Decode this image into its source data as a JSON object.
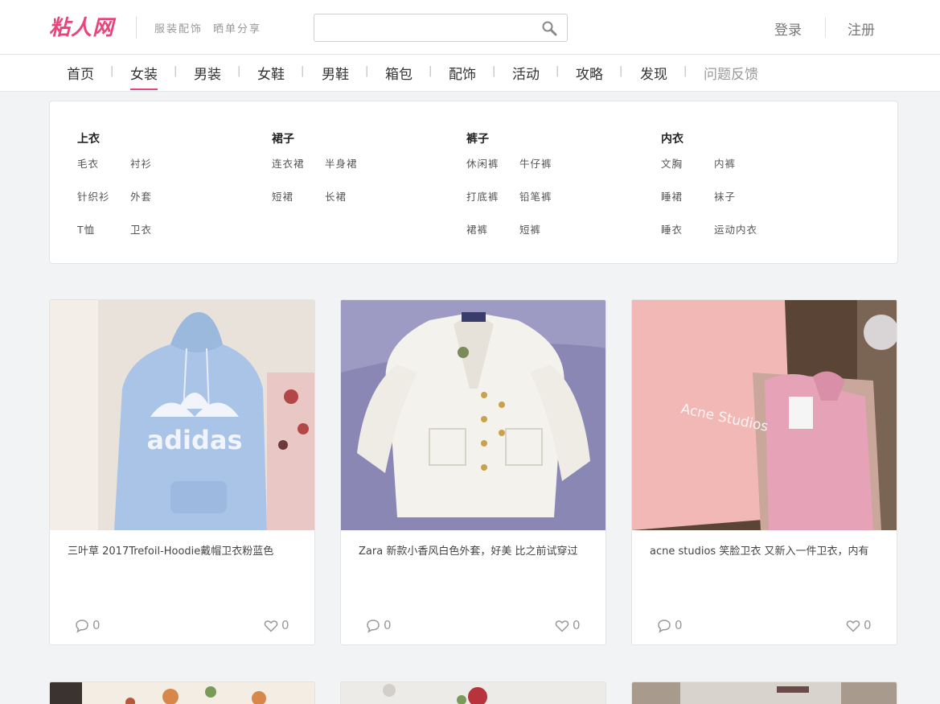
{
  "header": {
    "logo": "粘人网",
    "taglines": [
      "服装配饰",
      "晒单分享"
    ],
    "search": {
      "value": "",
      "placeholder": ""
    },
    "login": "登录",
    "register": "注册"
  },
  "nav": {
    "items": [
      "首页",
      "女装",
      "男装",
      "女鞋",
      "男鞋",
      "箱包",
      "配饰",
      "活动",
      "攻略",
      "发现",
      "问题反馈"
    ],
    "active": "女装",
    "separator": "|"
  },
  "categories": [
    {
      "title": "上衣",
      "links": [
        "毛衣",
        "衬衫",
        "针织衫",
        "外套",
        "T恤",
        "卫衣"
      ]
    },
    {
      "title": "裙子",
      "links": [
        "连衣裙",
        "半身裙",
        "短裙",
        "长裙"
      ]
    },
    {
      "title": "裤子",
      "links": [
        "休闲裤",
        "牛仔裤",
        "打底裤",
        "铅笔裤",
        "裙裤",
        "短裤"
      ]
    },
    {
      "title": "内衣",
      "links": [
        "文胸",
        "内裤",
        "睡裙",
        "袜子",
        "睡衣",
        "运动内衣"
      ]
    }
  ],
  "cards": [
    {
      "title": "三叶草 2017Trefoil-Hoodie戴帽卫衣粉蓝色",
      "comments": "0",
      "likes": "0",
      "image_text": "adidas"
    },
    {
      "title": "Zara 新款小香风白色外套，好美 比之前试穿过",
      "comments": "0",
      "likes": "0"
    },
    {
      "title": "acne studios 笑脸卫衣 又新入一件卫衣，内有",
      "comments": "0",
      "likes": "0",
      "image_text": "Acne Studios"
    }
  ],
  "colors": {
    "brand": "#e8457c",
    "page_bg": "#f2f3f5"
  }
}
